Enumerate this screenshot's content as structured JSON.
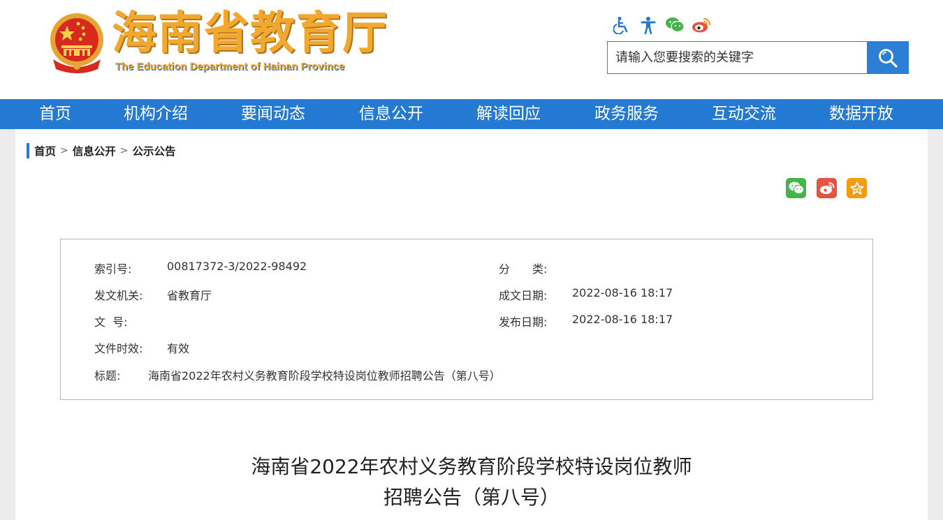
{
  "header": {
    "title": "海南省教育厅",
    "subtitle": "The Education Department of Hainan Province",
    "top_icons": [
      "accessibility-icon",
      "elder-mode-icon",
      "wechat-icon",
      "weibo-icon"
    ]
  },
  "search": {
    "placeholder": "请输入您要搜索的关键字"
  },
  "nav": {
    "items": [
      {
        "label": "首页"
      },
      {
        "label": "机构介绍"
      },
      {
        "label": "要闻动态"
      },
      {
        "label": "信息公开"
      },
      {
        "label": "解读回应"
      },
      {
        "label": "政务服务"
      },
      {
        "label": "互动交流"
      },
      {
        "label": "数据开放"
      }
    ]
  },
  "breadcrumb": {
    "items": [
      "首页",
      "信息公开",
      "公示公告"
    ],
    "separator": ">"
  },
  "share": {
    "icons": [
      "wechat-share-icon",
      "weibo-share-icon",
      "favorite-icon"
    ]
  },
  "meta": {
    "index_label": "索引号:",
    "index_value": "00817372-3/2022-98492",
    "category_label": "分　　类:",
    "category_value": "",
    "issuer_label": "发文机关:",
    "issuer_value": "省教育厅",
    "created_label": "成文日期:",
    "created_value": "2022-08-16 18:17",
    "docno_label": "文  号:",
    "docno_value": "",
    "published_label": "发布日期:",
    "published_value": "2022-08-16 18:17",
    "validity_label": "文件时效:",
    "validity_value": "有效",
    "title_label": "标题:",
    "title_value": "海南省2022年农村义务教育阶段学校特设岗位教师招聘公告（第八号）"
  },
  "article": {
    "title_line1": "海南省2022年农村义务教育阶段学校特设岗位教师",
    "title_line2": "招聘公告（第八号）"
  },
  "colors": {
    "primary_blue": "#2479d2",
    "title_gold": "#f0a92e",
    "wechat_green": "#44b549",
    "weibo_red": "#e8533f",
    "favorite_orange": "#f39c12"
  }
}
